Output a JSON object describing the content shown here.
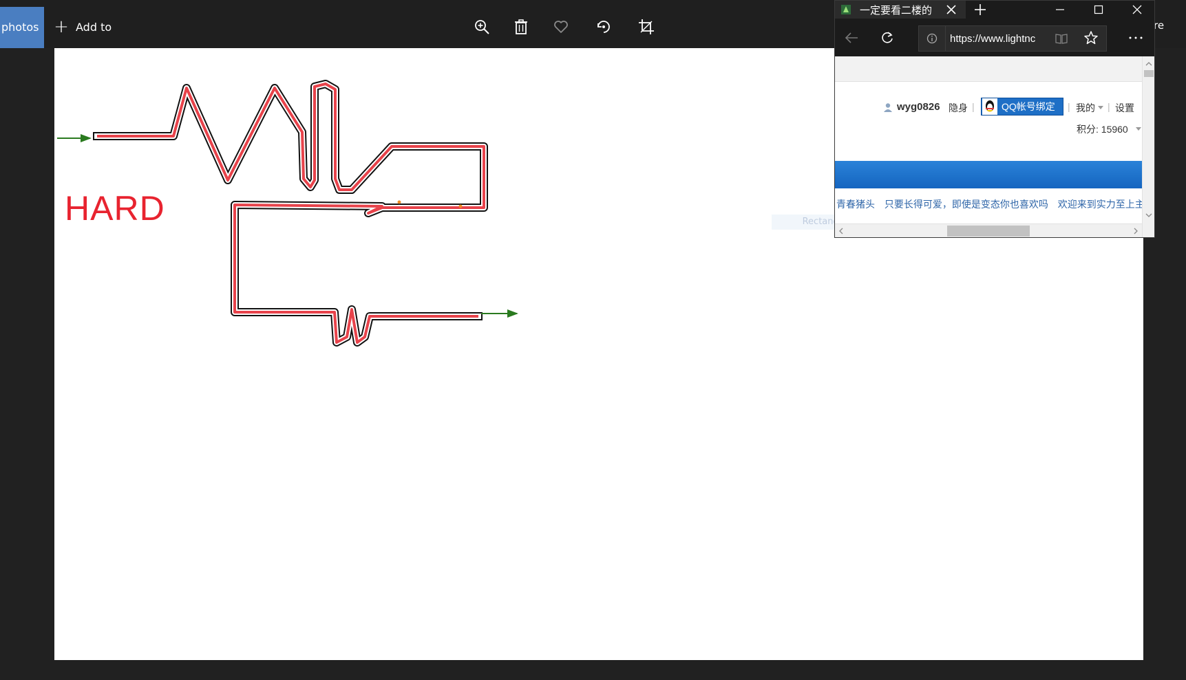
{
  "photos_app": {
    "tab_label": "photos",
    "add_to_label": "Add to",
    "share_partial": "re",
    "icons": [
      "zoom-in-icon",
      "trash-icon",
      "heart-icon",
      "rotate-icon",
      "crop-icon"
    ]
  },
  "photo": {
    "hard_label": "HARD",
    "snip_overlay_text": "Rectangular Snip"
  },
  "browser": {
    "tab_title": "一定要看二楼的",
    "url": "https://www.lightnc",
    "content": {
      "username": "wyg0826",
      "stealth": "隐身",
      "qq_bind": "QQ帐号绑定",
      "mine": "我的",
      "settings": "设置",
      "points": "积分: 15960",
      "ticker": [
        "青春猪头",
        "只要长得可爱，即使是变态你也喜欢吗",
        "欢迎来到实力至上主义的教室"
      ]
    }
  },
  "colors": {
    "maze_path": "#e8434b",
    "arrow": "#2a7a1f",
    "hard_text": "#e8232f",
    "photos_accent": "#4a7ec1",
    "qq_blue": "#1e6fc6",
    "link_blue": "#2e65a8"
  }
}
